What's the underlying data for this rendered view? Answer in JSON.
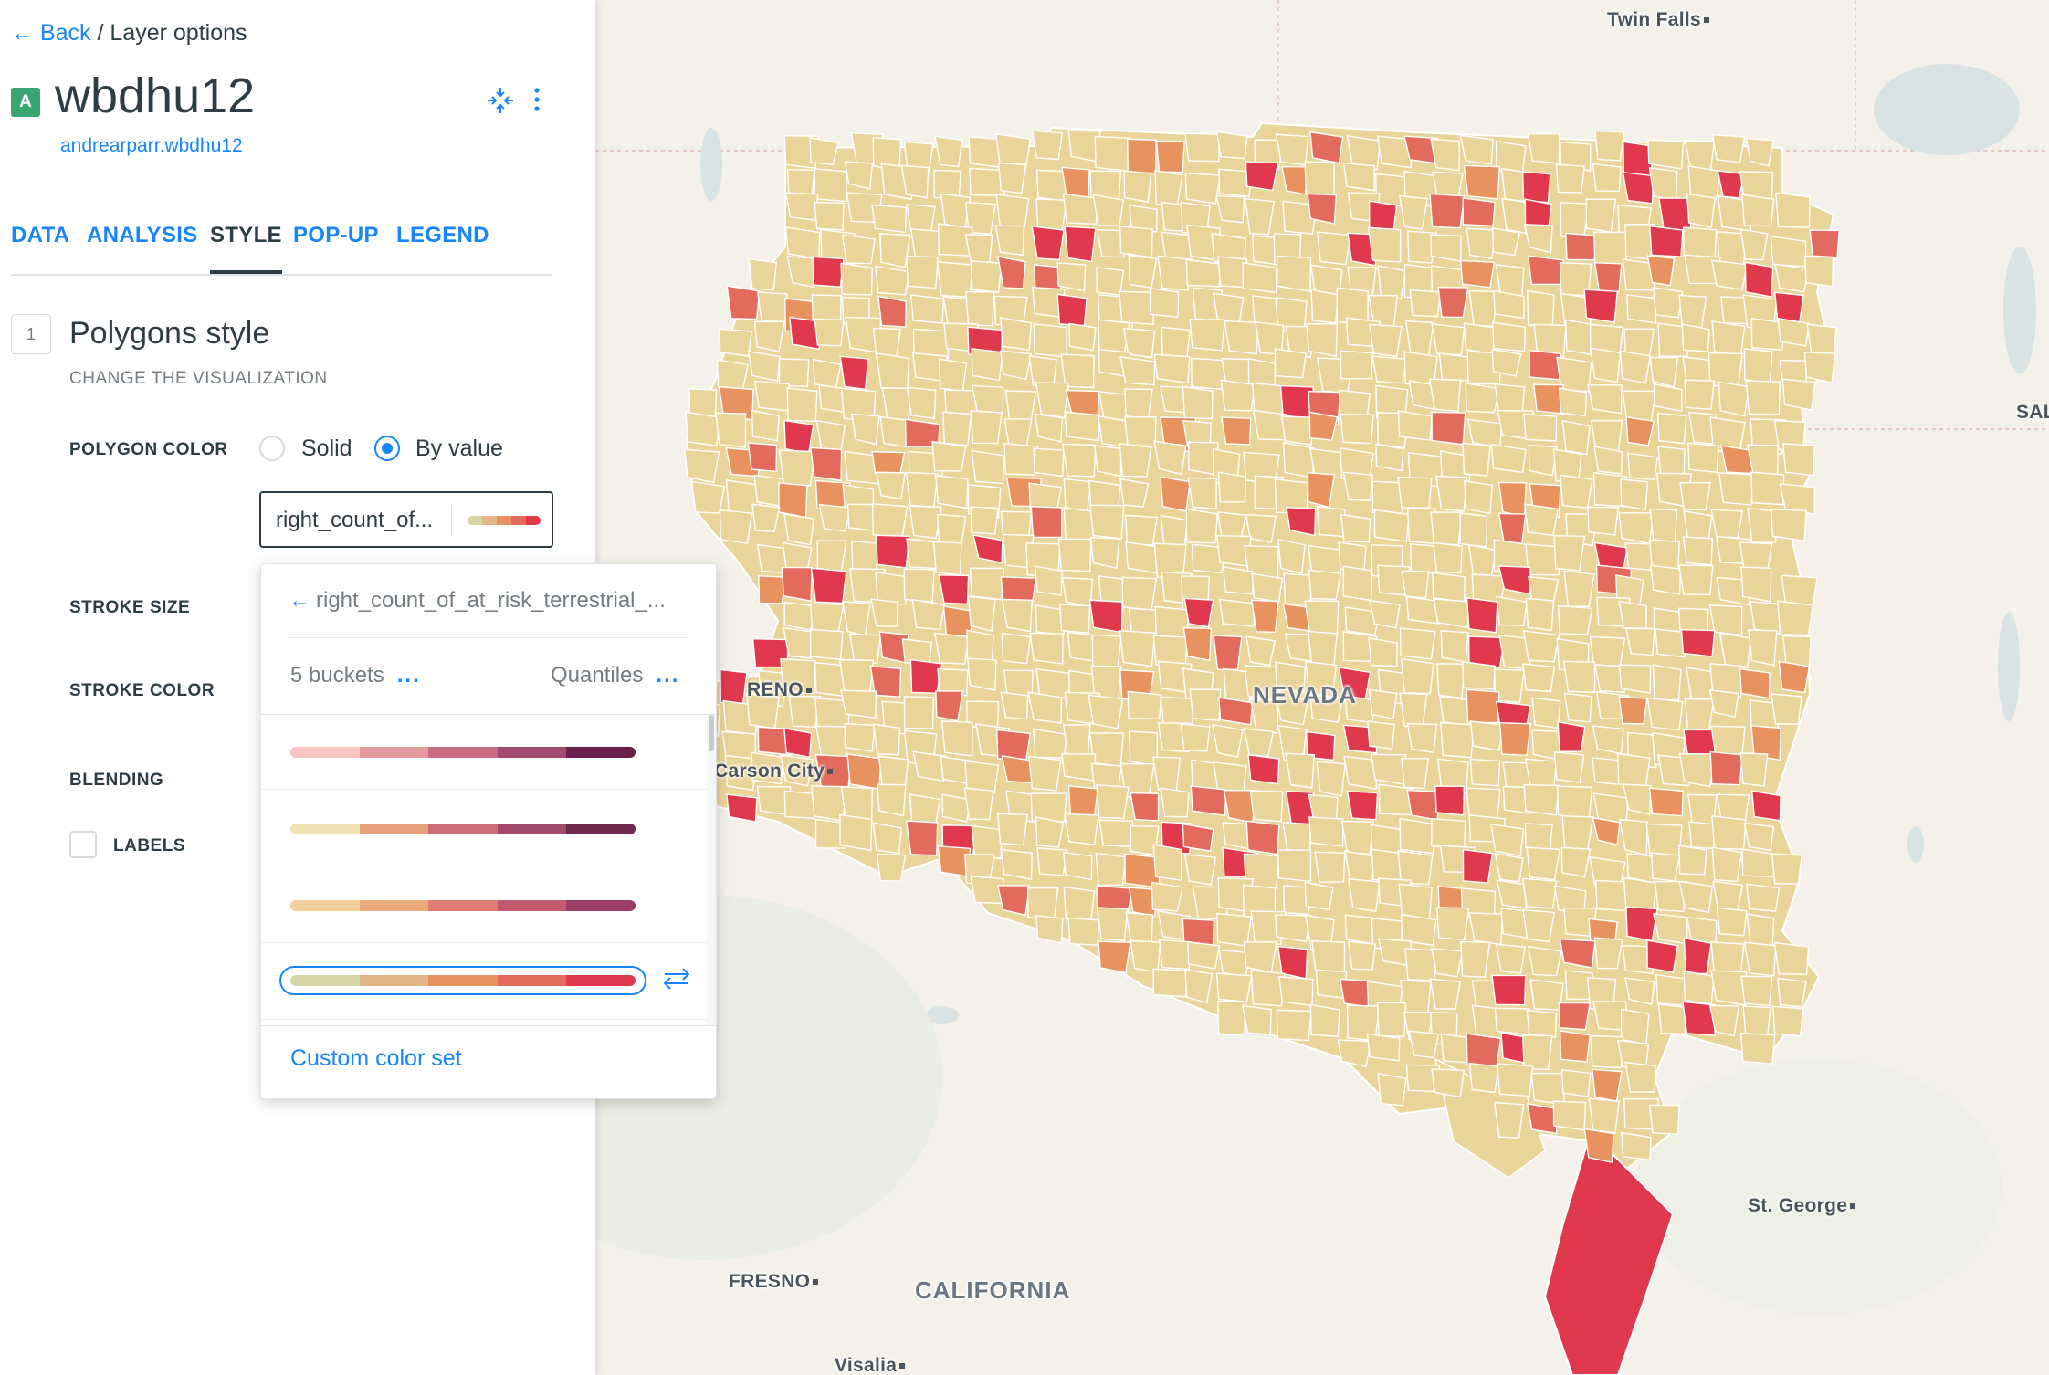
{
  "breadcrumb": {
    "back_label": "Back",
    "separator": "/",
    "current": "Layer options"
  },
  "layer": {
    "badge": "A",
    "name": "wbdhu12",
    "source": "andrearparr.wbdhu12"
  },
  "header_icons": [
    "compress-icon",
    "more-vertical-icon"
  ],
  "tabs": [
    {
      "label": "DATA",
      "active": false
    },
    {
      "label": "ANALYSIS",
      "active": false
    },
    {
      "label": "STYLE",
      "active": true
    },
    {
      "label": "POP-UP",
      "active": false
    },
    {
      "label": "LEGEND",
      "active": false
    }
  ],
  "section": {
    "step": "1",
    "title": "Polygons style",
    "subtitle": "CHANGE THE VISUALIZATION"
  },
  "polygon_color": {
    "label": "POLYGON COLOR",
    "options": [
      {
        "label": "Solid",
        "selected": false
      },
      {
        "label": "By value",
        "selected": true
      }
    ],
    "selected_field": "right_count_of...",
    "current_ramp": [
      "#d8d6a6",
      "#e3b685",
      "#e8925f",
      "#e36b5e",
      "#e0384d"
    ]
  },
  "fields": {
    "stroke_size": "STROKE SIZE",
    "stroke_color": "STROKE COLOR",
    "blending": "BLENDING",
    "labels": "LABELS"
  },
  "popup": {
    "field_name": "right_count_of_at_risk_terrestrial_...",
    "buckets_label": "5 buckets",
    "method_label": "Quantiles",
    "more_label": "...",
    "ramps": [
      {
        "colors": [
          "#f7c6c3",
          "#e59b9d",
          "#c96b82",
          "#a24a6f",
          "#6b1f4a"
        ],
        "selected": false
      },
      {
        "colors": [
          "#f1e3b6",
          "#e7a17f",
          "#cd6d78",
          "#a14a6c",
          "#6e2a4f"
        ],
        "selected": false
      },
      {
        "colors": [
          "#f0cf9d",
          "#ecab7e",
          "#df7e70",
          "#c25a6d",
          "#9b3f66"
        ],
        "selected": false
      },
      {
        "colors": [
          "#d8d6a6",
          "#e3b685",
          "#e8925f",
          "#e36b5e",
          "#e0384d"
        ],
        "selected": true
      }
    ],
    "custom_label": "Custom color set"
  },
  "map": {
    "cities": [
      {
        "name": "Twin Falls",
        "dot": true
      },
      {
        "name": "SAL",
        "dot": false
      },
      {
        "name": "RENO",
        "dot": true
      },
      {
        "name": "Carson City",
        "dot": true
      },
      {
        "name": "NEVADA",
        "dot": false
      },
      {
        "name": "St. George",
        "dot": true
      },
      {
        "name": "FRESNO",
        "dot": true
      },
      {
        "name": "CALIFORNIA",
        "dot": false
      },
      {
        "name": "Visalia",
        "dot": true
      }
    ],
    "colors": {
      "base": "#e9d49a",
      "low": "#e8925f",
      "mid": "#e36b5e",
      "high": "#e0384d",
      "boundary": "#ffffff",
      "water": "#d8e4e3"
    }
  }
}
